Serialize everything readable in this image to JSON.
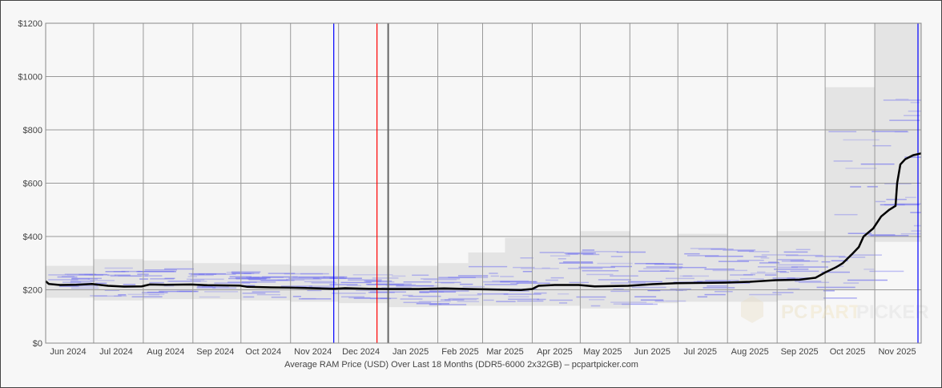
{
  "chart_data": {
    "type": "line",
    "title": "Average RAM Price (USD) Over Last 18 Months (DDR5-6000 2x32GB) – pcpartpicker.com",
    "xlabel": "",
    "ylabel": "",
    "xlim": [
      "2024-06-01",
      "2025-11-30"
    ],
    "ylim": [
      0,
      1200
    ],
    "y_ticks": [
      0,
      200,
      400,
      600,
      800,
      1000,
      1200
    ],
    "y_tick_labels": [
      "$0",
      "$200",
      "$400",
      "$600",
      "$800",
      "$1000",
      "$1200"
    ],
    "x_tick_labels": [
      "Jun 2024",
      "Jul 2024",
      "Aug 2024",
      "Sep 2024",
      "Oct 2024",
      "Nov 2024",
      "Dec 2024",
      "Jan 2025",
      "Feb 2025",
      "Mar 2025",
      "Apr 2025",
      "May 2025",
      "Jun 2025",
      "Jul 2025",
      "Aug 2025",
      "Sep 2025",
      "Oct 2025",
      "Nov 2025"
    ],
    "grid": true,
    "colors": {
      "average": "#000000",
      "range": "#e4e4e4",
      "listings": "#6f6fef",
      "grid": "#999999",
      "background": "#f7f7f7"
    },
    "markers": [
      {
        "date": "2024-11-28",
        "color": "#0000ff"
      },
      {
        "date": "2024-12-25",
        "color": "#ff0000"
      },
      {
        "date": "2025-01-01",
        "color": "#666666"
      },
      {
        "date": "2025-11-28",
        "color": "#0000ff"
      }
    ],
    "series": [
      {
        "points": [
          [
            "2024-06-01",
            232
          ],
          [
            "2024-06-03",
            222
          ],
          [
            "2024-06-10",
            218
          ],
          [
            "2024-06-20",
            219
          ],
          [
            "2024-06-30",
            222
          ],
          [
            "2024-07-10",
            215
          ],
          [
            "2024-07-20",
            212
          ],
          [
            "2024-07-31",
            213
          ],
          [
            "2024-08-05",
            220
          ],
          [
            "2024-08-15",
            219
          ],
          [
            "2024-08-31",
            220
          ],
          [
            "2024-09-10",
            217
          ],
          [
            "2024-09-30",
            216
          ],
          [
            "2024-10-05",
            211
          ],
          [
            "2024-10-20",
            209
          ],
          [
            "2024-10-31",
            208
          ],
          [
            "2024-11-15",
            206
          ],
          [
            "2024-11-28",
            204
          ],
          [
            "2024-12-05",
            206
          ],
          [
            "2024-12-20",
            204
          ],
          [
            "2025-01-01",
            203
          ],
          [
            "2025-01-20",
            203
          ],
          [
            "2025-02-05",
            205
          ],
          [
            "2025-02-20",
            203
          ],
          [
            "2025-03-10",
            201
          ],
          [
            "2025-03-25",
            199
          ],
          [
            "2025-04-01",
            203
          ],
          [
            "2025-04-05",
            215
          ],
          [
            "2025-04-15",
            218
          ],
          [
            "2025-04-30",
            218
          ],
          [
            "2025-05-10",
            213
          ],
          [
            "2025-05-31",
            215
          ],
          [
            "2025-06-15",
            221
          ],
          [
            "2025-06-30",
            225
          ],
          [
            "2025-07-15",
            226
          ],
          [
            "2025-07-31",
            227
          ],
          [
            "2025-08-15",
            230
          ],
          [
            "2025-08-31",
            236
          ],
          [
            "2025-09-15",
            238
          ],
          [
            "2025-09-25",
            245
          ],
          [
            "2025-10-01",
            265
          ],
          [
            "2025-10-08",
            285
          ],
          [
            "2025-10-12",
            300
          ],
          [
            "2025-10-18",
            335
          ],
          [
            "2025-10-22",
            360
          ],
          [
            "2025-10-25",
            400
          ],
          [
            "2025-10-31",
            430
          ],
          [
            "2025-11-05",
            475
          ],
          [
            "2025-11-10",
            500
          ],
          [
            "2025-11-14",
            515
          ],
          [
            "2025-11-15",
            600
          ],
          [
            "2025-11-17",
            670
          ],
          [
            "2025-11-20",
            690
          ],
          [
            "2025-11-25",
            705
          ],
          [
            "2025-11-30",
            712
          ]
        ]
      }
    ],
    "price_range": [
      [
        "2024-06-01",
        170,
        290
      ],
      [
        "2024-07-01",
        160,
        315
      ],
      [
        "2024-08-01",
        165,
        310
      ],
      [
        "2024-09-01",
        165,
        300
      ],
      [
        "2024-10-01",
        160,
        295
      ],
      [
        "2024-11-01",
        155,
        290
      ],
      [
        "2024-12-01",
        150,
        290
      ],
      [
        "2025-01-01",
        135,
        290
      ],
      [
        "2025-02-01",
        140,
        300
      ],
      [
        "2025-02-20",
        140,
        340
      ],
      [
        "2025-03-15",
        140,
        395
      ],
      [
        "2025-04-01",
        140,
        400
      ],
      [
        "2025-05-01",
        130,
        420
      ],
      [
        "2025-06-01",
        150,
        400
      ],
      [
        "2025-07-01",
        155,
        410
      ],
      [
        "2025-08-01",
        155,
        400
      ],
      [
        "2025-09-01",
        160,
        420
      ],
      [
        "2025-10-01",
        200,
        960
      ],
      [
        "2025-10-20",
        200,
        960
      ],
      [
        "2025-11-01",
        380,
        1200
      ],
      [
        "2025-11-30",
        370,
        1200
      ]
    ]
  },
  "watermark": "PCPARTPICKER"
}
